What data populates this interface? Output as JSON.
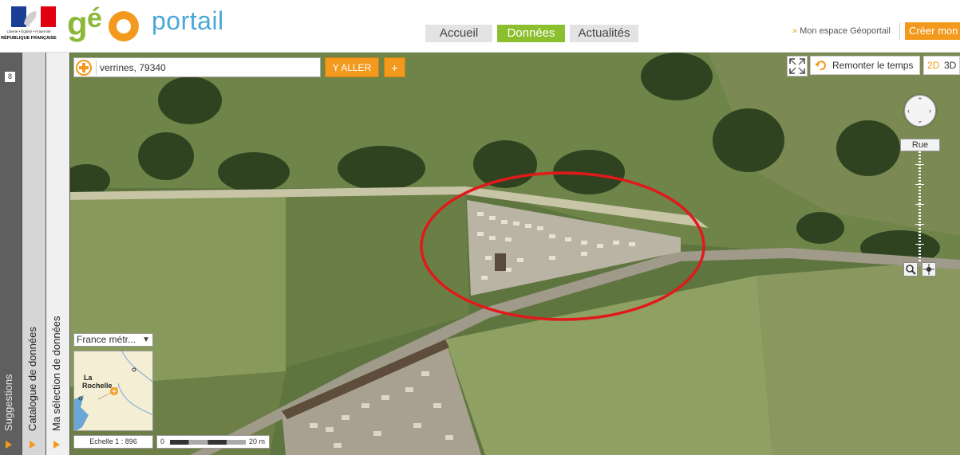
{
  "header": {
    "rf_logo": {
      "motto": "Liberté • Égalité • Fraternité",
      "republic": "RÉPUBLIQUE FRANÇAISE"
    },
    "brand": {
      "g": "g",
      "e": "é",
      "portail": "portail"
    },
    "nav": [
      {
        "label": "Accueil",
        "active": false
      },
      {
        "label": "Données",
        "active": true
      },
      {
        "label": "Actualités",
        "active": false
      }
    ],
    "mon_espace": "Mon espace Géoportail",
    "creer": "Créer mon"
  },
  "left_panels": {
    "count": "8",
    "suggestions": "Suggestions",
    "catalogue": "Catalogue de données",
    "selection": "Ma sélection de données"
  },
  "map": {
    "search": {
      "value": "verrines, 79340",
      "go_label": "Y ALLER",
      "plus_label": "+"
    },
    "time_label": "Remonter le temps",
    "dim_2d": "2D",
    "dim_3d": "3D",
    "zoom_level_label": "Rue",
    "minimap": {
      "territory": "France métr...",
      "city_label_1": "La",
      "city_label_2": "Rochelle"
    },
    "scale": {
      "text": "Echelle 1 :   896",
      "zero": "0",
      "max": "20 m"
    },
    "annotation_color": "#e01a1a"
  },
  "colors": {
    "accent": "#f39a1e",
    "active_nav": "#8cbf2e",
    "brand_blue": "#4aa8d8"
  }
}
